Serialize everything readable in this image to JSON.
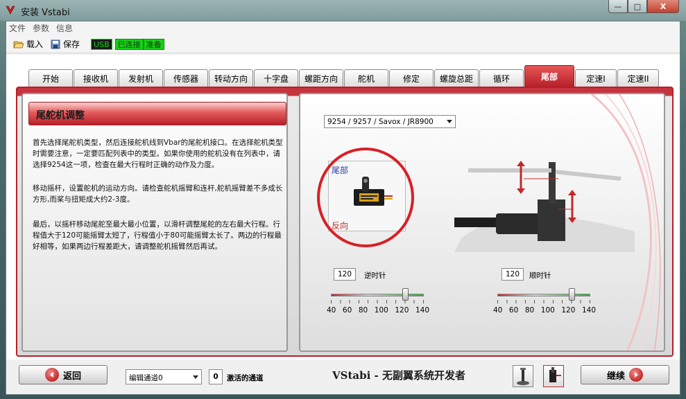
{
  "window": {
    "title": "安装 Vstabi",
    "min_label": "—",
    "max_label": "□",
    "close_label": "X"
  },
  "menu": [
    "文件",
    "参数",
    "信息"
  ],
  "toolbar": {
    "load_label": "载入",
    "save_label": "保存",
    "status_usb": "USB",
    "status_connected": "已连接",
    "status_ready": "准备"
  },
  "tabs": [
    {
      "label": "开始",
      "active": false
    },
    {
      "label": "接收机",
      "active": false
    },
    {
      "label": "发射机",
      "active": false
    },
    {
      "label": "传感器",
      "active": false
    },
    {
      "label": "转动方向",
      "active": false
    },
    {
      "label": "十字盘",
      "active": false
    },
    {
      "label": "螺距方向",
      "active": false
    },
    {
      "label": "舵机",
      "active": false
    },
    {
      "label": "修定",
      "active": false
    },
    {
      "label": "螺旋总距",
      "active": false
    },
    {
      "label": "循环",
      "active": false
    },
    {
      "label": "尾部",
      "active": true
    },
    {
      "label": "定速I",
      "active": false
    },
    {
      "label": "定速II",
      "active": false
    }
  ],
  "left": {
    "title": "尾舵机调整",
    "paragraphs": [
      "首先选择尾舵机类型，然后连接舵机线到Vbar的尾舵机接口。在选择舵机类型时需要注意，一定要匹配列表中的类型。如果你使用的舵机没有在列表中，请选择9254这一项，检查在最大行程时正确的动作及力度。",
      "移动摇杆，设置舵机的运动方向。请检查舵机摇臂和连杆,舵机摇臂差不多成长方形,而桨与扭矩成大约2-3度。",
      "最后，以摇杆移动尾舵至最大最小位置，以滑杆调整尾舵的左右最大行程。行程值大于120可能摇臂太短了，行程值小于80可能摇臂太长了。两边的行程最好相等，如果两边行程差距大，请调整舵机摇臂然后再试。"
    ]
  },
  "right": {
    "servo_select": "9254 / 9257 / Savox / JR8900",
    "servo_label_top": "尾部",
    "servo_label_bottom": "反向",
    "ccw_value": "120",
    "ccw_label": "逆时针",
    "cw_value": "120",
    "cw_label": "顺时针",
    "slider_ticks": [
      "40",
      "60",
      "80",
      "100",
      "120",
      "140"
    ],
    "ccw_slider_value": 120,
    "cw_slider_value": 120,
    "slider_min": 40,
    "slider_max": 140
  },
  "bottom": {
    "back_label": "返回",
    "channel_select": "编辑通道0",
    "active_channel_value": "0",
    "active_channel_label": "激活的通道",
    "brand": "VStabi - 无副翼系统开发者",
    "continue_label": "继续"
  },
  "colors": {
    "accent_red": "#b51f2a",
    "status_green": "#18d018"
  }
}
